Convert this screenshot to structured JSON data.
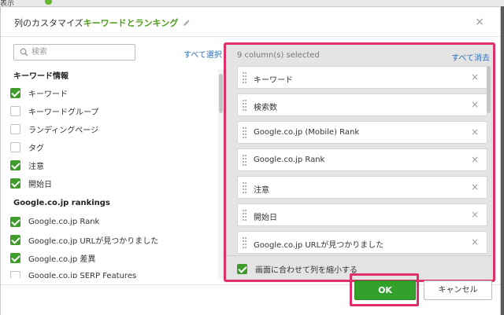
{
  "background": {
    "text": "表示"
  },
  "dialog": {
    "title_prefix": "列のカスタマイズ",
    "title_accent": "キーワードとランキング",
    "close_glyph": "×"
  },
  "left": {
    "search_placeholder": "検索",
    "select_all": "すべて選択",
    "groups": [
      {
        "heading": "キーワード情報",
        "options": [
          {
            "label": "キーワード",
            "checked": true
          },
          {
            "label": "キーワードグループ",
            "checked": false
          },
          {
            "label": "ランディングページ",
            "checked": false
          },
          {
            "label": "タグ",
            "checked": false
          },
          {
            "label": "注意",
            "checked": true
          },
          {
            "label": "開始日",
            "checked": true
          }
        ]
      },
      {
        "heading": "Google.co.jp rankings",
        "options": [
          {
            "label": "Google.co.jp Rank",
            "checked": true
          },
          {
            "label": "Google.co.jp URLが見つかりました",
            "checked": true
          },
          {
            "label": "Google.co.jp 差異",
            "checked": true
          },
          {
            "label": "Google.co.jp SERP Features",
            "checked": false
          }
        ]
      }
    ]
  },
  "right": {
    "count_text": "9 column(s) selected",
    "clear_all": "すべて消去",
    "items": [
      "キーワード",
      "検索数",
      "Google.co.jp (Mobile) Rank",
      "Google.co.jp Rank",
      "注意",
      "開始日",
      "Google.co.jp URLが見つかりました"
    ],
    "remove_glyph": "×",
    "shrink_label": "画面に合わせて列を縮小する",
    "shrink_checked": true
  },
  "footer": {
    "ok": "OK",
    "cancel": "キャンセル"
  },
  "colors": {
    "accent_green": "#4c9b17",
    "checkbox_green": "#3f9b2b",
    "highlight_pink": "#e0306a",
    "link_blue": "#2f6fb7",
    "ok_green": "#33a02c"
  }
}
